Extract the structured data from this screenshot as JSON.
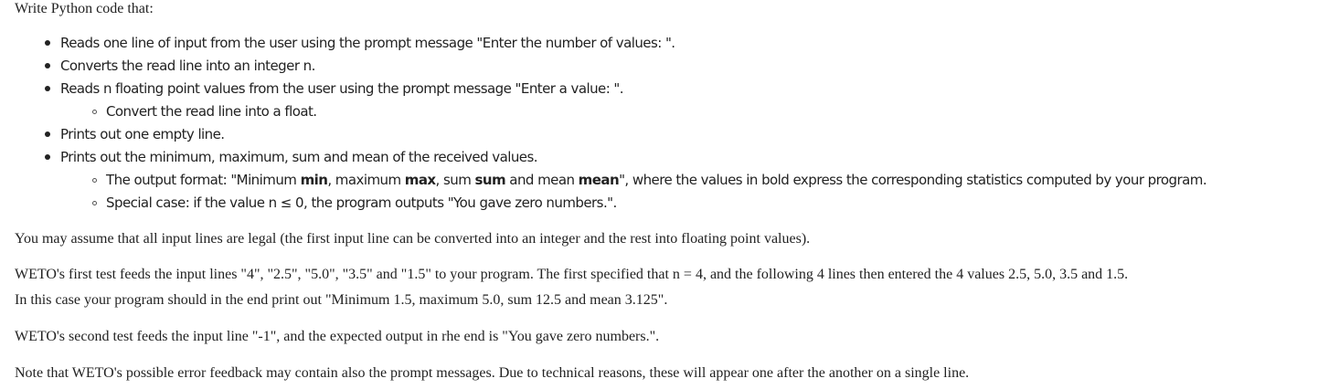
{
  "intro": "Write Python code that:",
  "bullets": {
    "b1": "Reads one line of input from the user using the prompt message \"Enter the number of values: \".",
    "b2": "Converts the read line into an integer n.",
    "b3": "Reads n floating point values from the user using the prompt message \"Enter a value: \".",
    "b3_sub1": "Convert the read line into a float.",
    "b4": "Prints out one empty line.",
    "b5": "Prints out the minimum, maximum, sum and mean of the received values.",
    "b5_sub1": {
      "part1": "The output format: \"Minimum ",
      "bold_min": "min",
      "part2": ", maximum ",
      "bold_max": "max",
      "part3": ", sum ",
      "bold_sum": "sum",
      "part4": " and mean ",
      "bold_mean": "mean",
      "part5": "\", where the values in bold express the corresponding statistics computed by your program."
    },
    "b5_sub2": "Special case: if the value n ≤ 0, the program outputs \"You gave zero numbers.\"."
  },
  "paragraphs": {
    "assume": "You may assume that all input lines are legal (the first input line can be converted into an integer and the rest into floating point values).",
    "test1_line1": "WETO's first test feeds the input lines \"4\", \"2.5\", \"5.0\", \"3.5\" and \"1.5\" to your program. The first specified that n = 4, and the following 4 lines then entered the 4 values 2.5, 5.0, 3.5 and 1.5.",
    "test1_line2": "In this case your program should in the end print out \"Minimum 1.5, maximum 5.0, sum 12.5 and mean 3.125\".",
    "test2": "WETO's second test feeds the input line \"-1\", and the expected output in rhe end is \"You gave zero numbers.\".",
    "note": "Note that WETO's possible error feedback may contain also the prompt messages. Due to technical reasons, these will appear one after the another on a single line."
  }
}
